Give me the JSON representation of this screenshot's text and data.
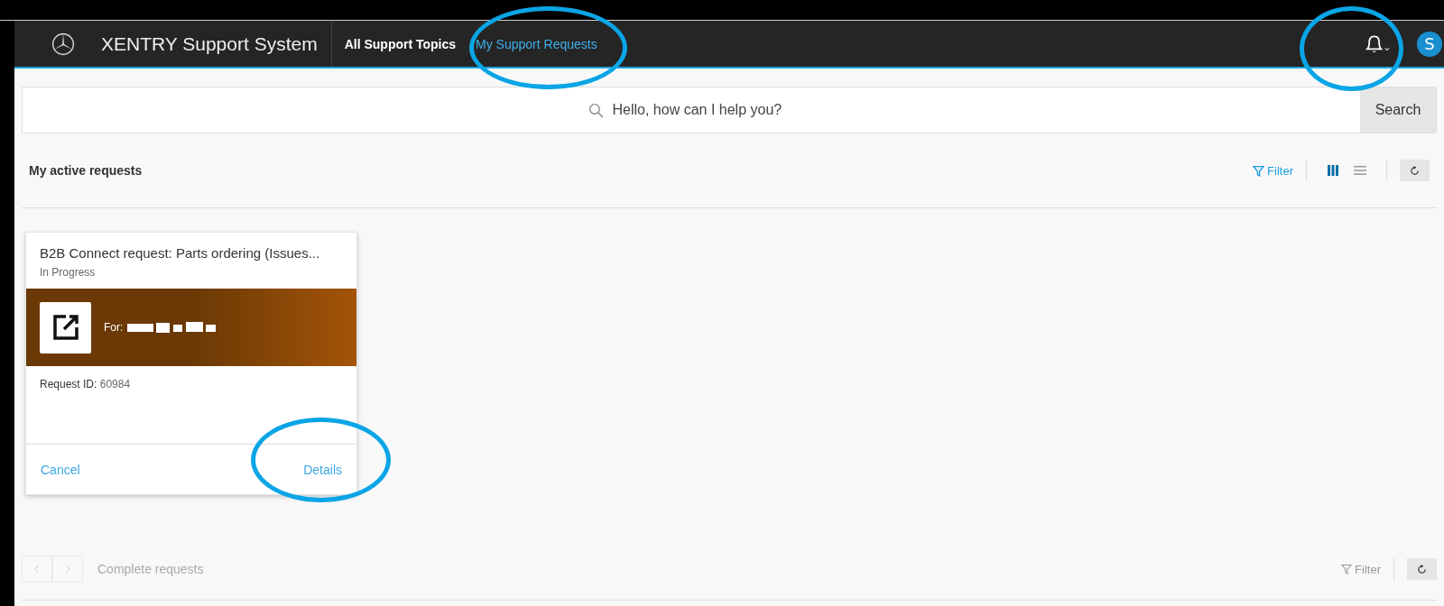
{
  "header": {
    "title": "XENTRY Support System",
    "nav": [
      {
        "label": "All Support Topics",
        "selected": false
      },
      {
        "label": "My Support Requests",
        "selected": true
      }
    ],
    "avatar": "S"
  },
  "search": {
    "placeholder": "Hello, how can I help you?",
    "button": "Search"
  },
  "active": {
    "title": "My active requests",
    "filter": "Filter",
    "views": [
      {
        "kind": "grid",
        "selected": true
      },
      {
        "kind": "list",
        "selected": false
      }
    ],
    "cards": [
      {
        "title": "B2B Connect request: Parts ordering (Issues...",
        "status": "In Progress",
        "for_label": "For:",
        "id_label": "Request ID:",
        "id_value": "60984",
        "actions": [
          "Cancel",
          "Details"
        ]
      }
    ]
  },
  "complete": {
    "title": "Complete requests",
    "filter": "Filter",
    "pager_disabled": true
  },
  "highlights": [
    {
      "kind": "nav"
    },
    {
      "kind": "bell"
    },
    {
      "kind": "details"
    }
  ]
}
